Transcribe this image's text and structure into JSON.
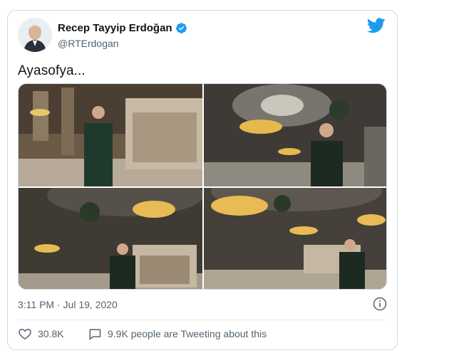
{
  "tweet": {
    "author_name": "Recep Tayyip Erdoğan",
    "author_handle": "@RTErdogan",
    "text": "Ayasofya...",
    "timestamp": "3:11 PM · Jul 19, 2020",
    "likes": "30.8K",
    "conversation_text": "9.9K people are Tweeting about this"
  },
  "icons": {
    "verified": "verified-badge-icon",
    "brand": "twitter-bird-icon",
    "info": "info-icon",
    "like": "heart-icon",
    "conversation": "speech-bubble-icon"
  },
  "colors": {
    "brand_blue": "#1d9bf0",
    "text_primary": "#0f1419",
    "text_secondary": "#536471",
    "border": "#cfd9de"
  }
}
